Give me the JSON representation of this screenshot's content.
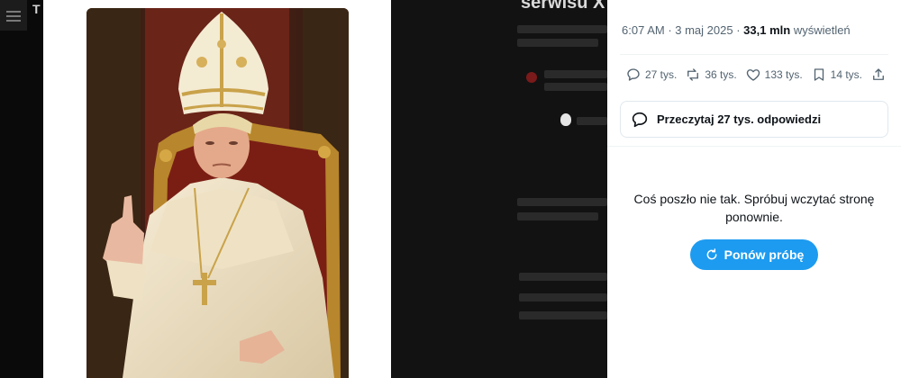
{
  "app": {
    "letter": "T"
  },
  "media": {
    "image_icon": "photo-portrait"
  },
  "background_page": {
    "heading_fragment": "serwisu X?"
  },
  "post": {
    "time": "6:07 AM",
    "separator": " · ",
    "date": "3 maj 2025",
    "views_count": "33,1 mln",
    "views_label": "wyświetleń",
    "actions": {
      "replies": "27 tys.",
      "reposts": "36 tys.",
      "likes": "133 tys.",
      "bookmarks": "14 tys."
    },
    "read_replies_label": "Przeczytaj 27 tys. odpowiedzi",
    "error_message": "Coś poszło nie tak. Spróbuj wczytać stronę ponownie.",
    "retry_label": "Ponów próbę"
  },
  "colors": {
    "accent": "#1d9bf0",
    "text_primary": "#0f1419",
    "text_secondary": "#536471"
  },
  "icons": [
    "reply-icon",
    "repost-icon",
    "like-icon",
    "bookmark-icon",
    "share-icon",
    "replies-bubble-icon",
    "refresh-icon",
    "menu-icon"
  ]
}
